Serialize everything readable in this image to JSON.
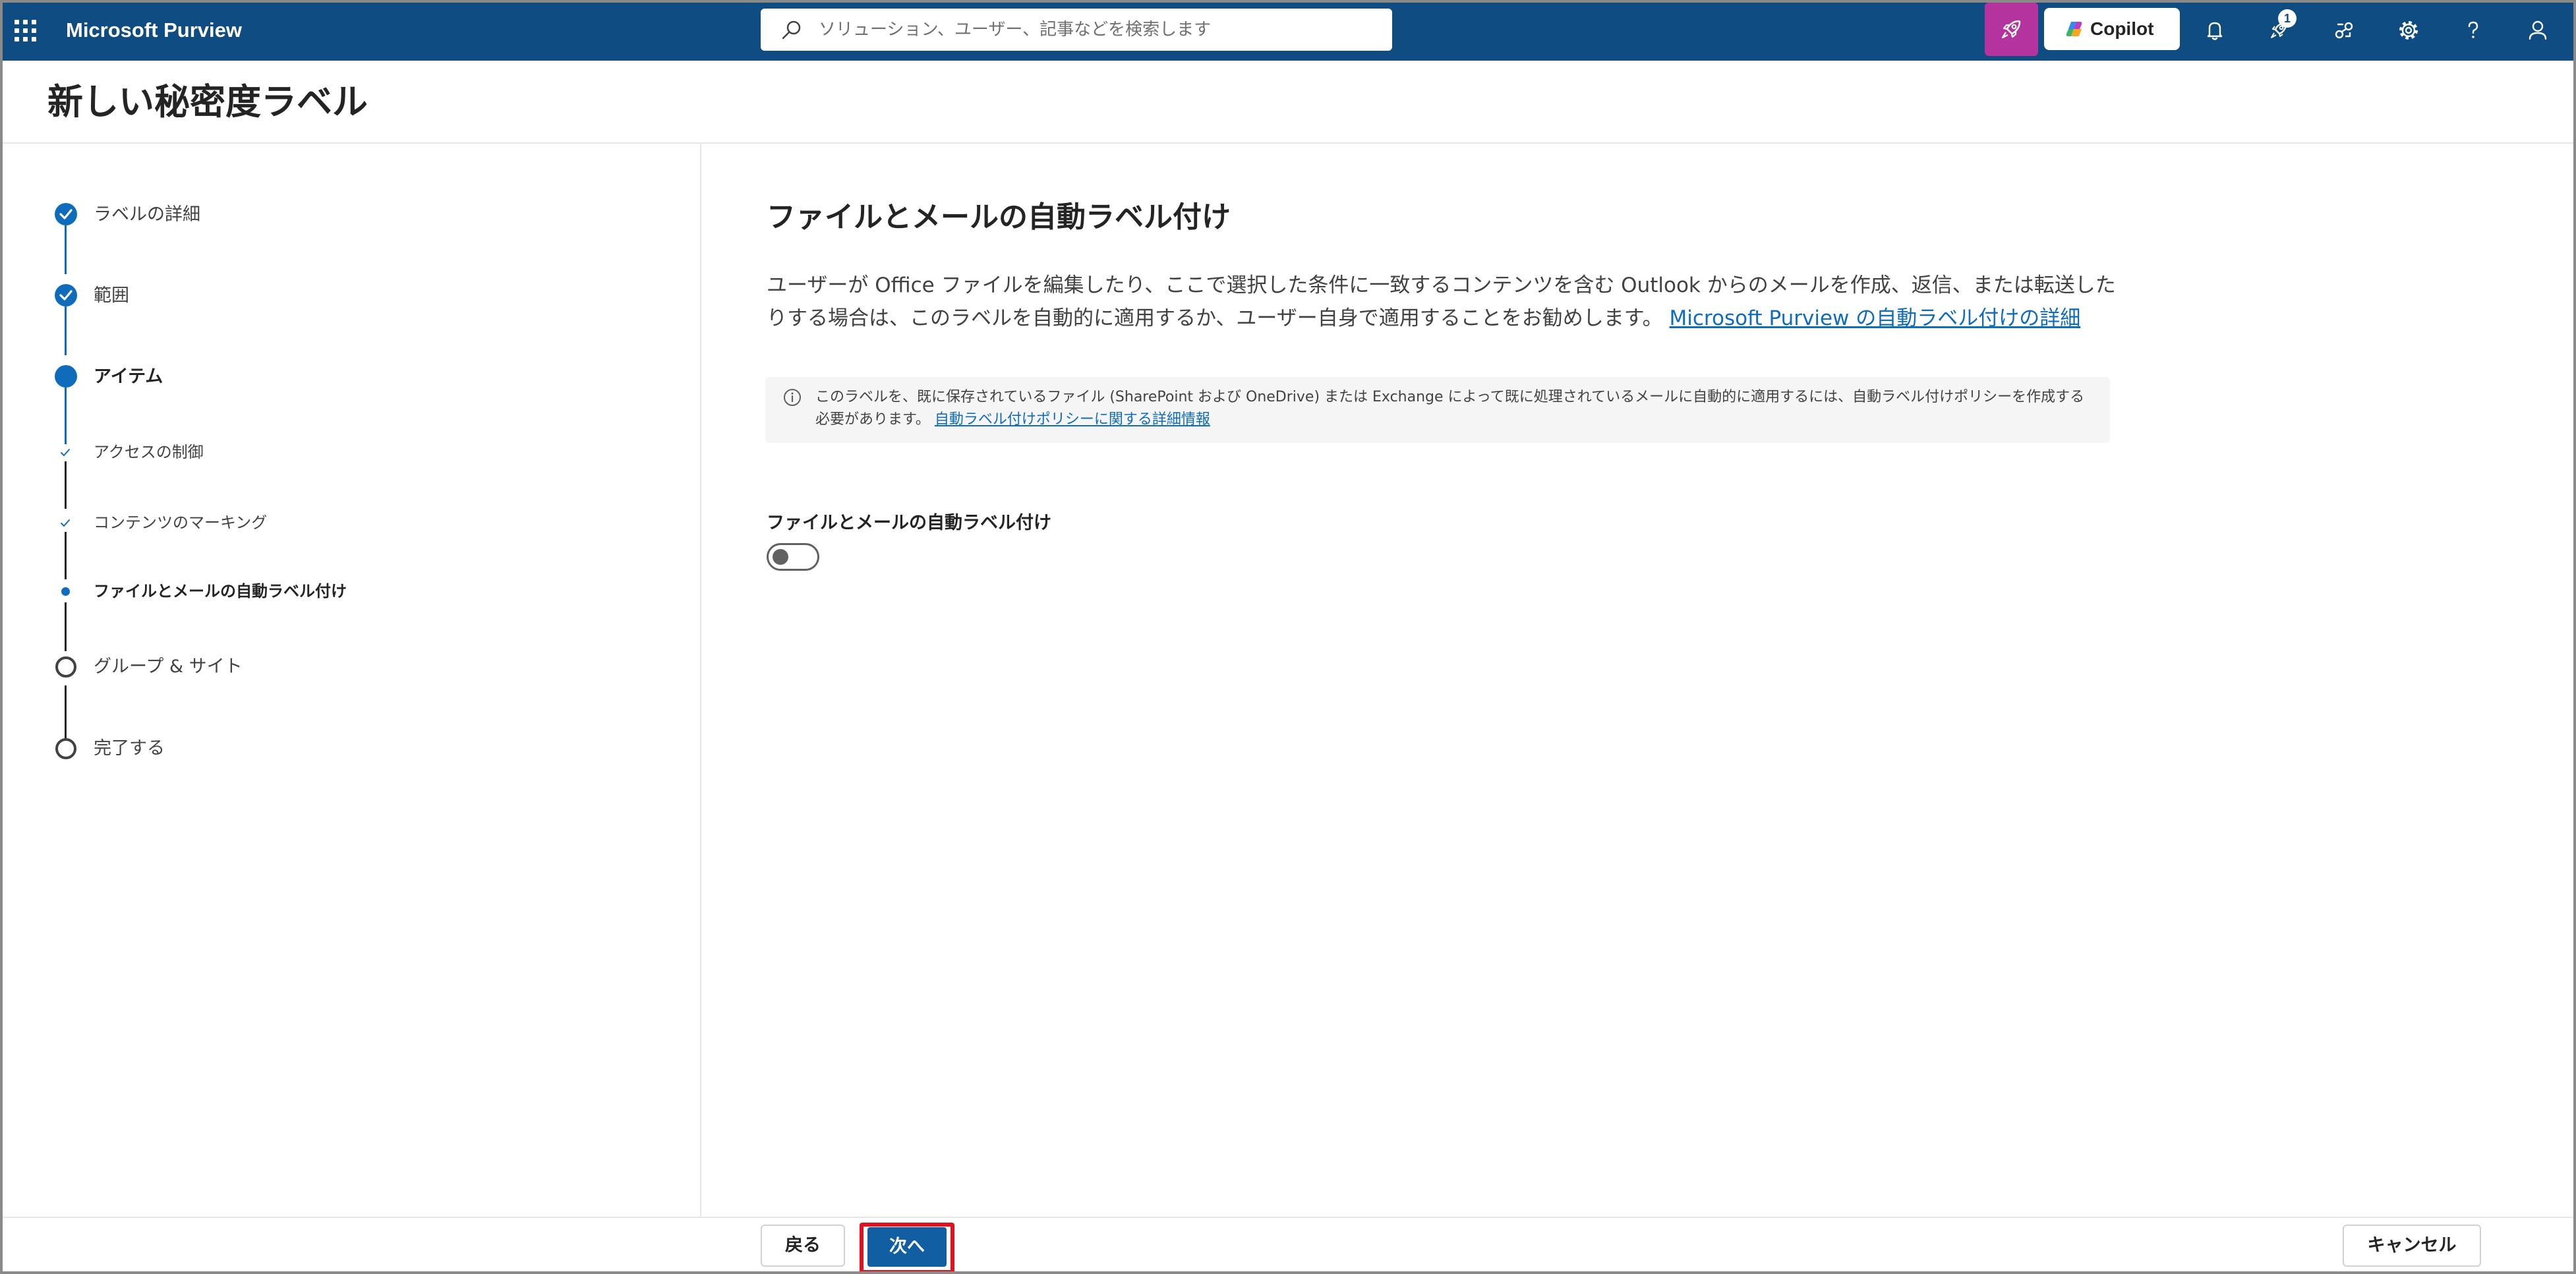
{
  "topbar": {
    "app_title": "Microsoft Purview",
    "search_placeholder": "ソリューション、ユーザー、記事などを検索します",
    "copilot_label": "Copilot",
    "notification_badge": "1",
    "icons": [
      "waffle-icon",
      "search-icon",
      "rocket-icon",
      "copilot-logo-icon",
      "bell-icon",
      "rocket-notification-icon",
      "connections-icon",
      "gear-icon",
      "help-icon",
      "person-icon"
    ]
  },
  "page": {
    "title": "新しい秘密度ラベル"
  },
  "wizard": {
    "steps": [
      {
        "label": "ラベルの詳細",
        "state": "completed"
      },
      {
        "label": "範囲",
        "state": "completed"
      },
      {
        "label": "アイテム",
        "state": "current"
      },
      {
        "label": "アクセスの制御",
        "state": "completed-substep"
      },
      {
        "label": "コンテンツのマーキング",
        "state": "completed-substep"
      },
      {
        "label": "ファイルとメールの自動ラベル付け",
        "state": "current-substep"
      },
      {
        "label": "グループ & サイト",
        "state": "not-started"
      },
      {
        "label": "完了する",
        "state": "not-started"
      }
    ]
  },
  "main": {
    "title": "ファイルとメールの自動ラベル付け",
    "description": "ユーザーが Office ファイルを編集したり、ここで選択した条件に一致するコンテンツを含む Outlook からのメールを作成、返信、または転送したりする場合は、このラベルを自動的に適用するか、ユーザー自身で適用することをお勧めします。",
    "description_link": "Microsoft Purview の自動ラベル付けの詳細",
    "info_text": "このラベルを、既に保存されているファイル (SharePoint および OneDrive) または Exchange によって既に処理されているメールに自動的に適用するには、自動ラベル付けポリシーを作成する必要があります。",
    "info_link": "自動ラベル付けポリシーに関する詳細情報",
    "toggle_label": "ファイルとメールの自動ラベル付け",
    "toggle_on": false
  },
  "footer": {
    "back_label": "戻る",
    "next_label": "次へ",
    "cancel_label": "キャンセル"
  },
  "colors": {
    "topbar": "#0f4c81",
    "accent": "#0f6cbd",
    "primary_button": "#115ea3",
    "copilot_button_bg": "#b4339e",
    "highlight": "#e0121f"
  }
}
